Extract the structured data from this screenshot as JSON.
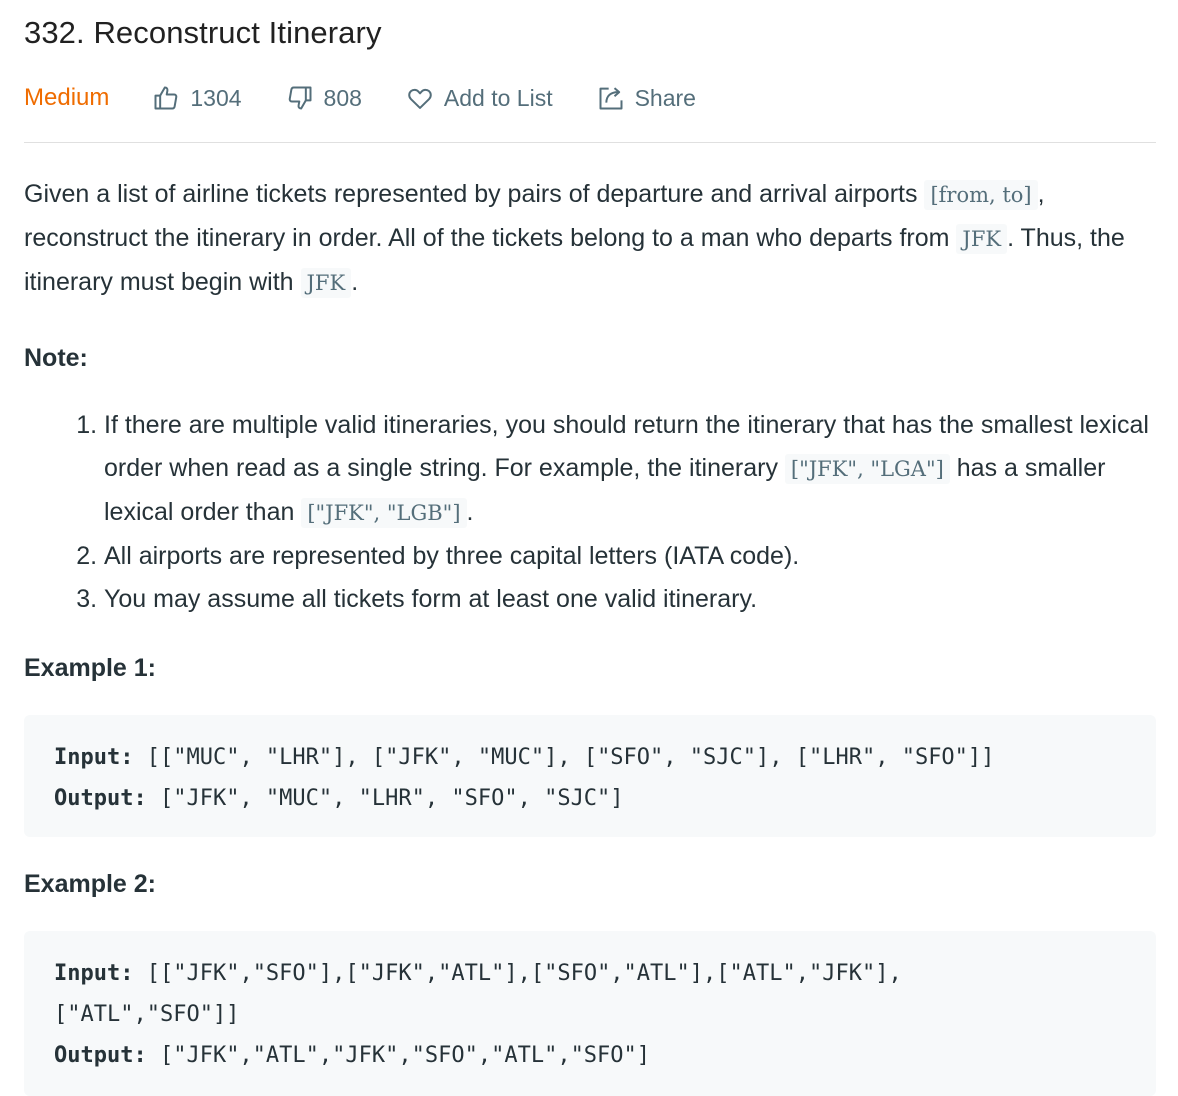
{
  "problem": {
    "title": "332. Reconstruct Itinerary",
    "difficulty": "Medium",
    "likes": "1304",
    "dislikes": "808",
    "add_to_list": "Add to List",
    "share": "Share",
    "colors": {
      "difficulty": "#ef6c00",
      "text": "#263238",
      "muted": "#546e7a",
      "code_bg": "#f7f9fa"
    }
  },
  "description": {
    "part1": "Given a list of airline tickets represented by pairs of departure and arrival airports ",
    "code_pair": "[from, to]",
    "part2": ", reconstruct the itinerary in order. All of the tickets belong to a man who departs from ",
    "code_jfk1": "JFK",
    "part3": ". Thus, the itinerary must begin with ",
    "code_jfk2": "JFK",
    "part4": "."
  },
  "note": {
    "title": "Note:",
    "item1_a": "If there are multiple valid itineraries, you should return the itinerary that has the smallest lexical order when read as a single string. For example, the itinerary ",
    "item1_code1": "[\"JFK\", \"LGA\"]",
    "item1_b": " has a smaller lexical order than ",
    "item1_code2": "[\"JFK\", \"LGB\"]",
    "item1_c": ".",
    "item2": "All airports are represented by three capital letters (IATA code).",
    "item3": "You may assume all tickets form at least one valid itinerary."
  },
  "examples": [
    {
      "title": "Example 1:",
      "input_label": "Input:",
      "input": " [[\"MUC\", \"LHR\"], [\"JFK\", \"MUC\"], [\"SFO\", \"SJC\"], [\"LHR\", \"SFO\"]]",
      "output_label": "Output:",
      "output": " [\"JFK\", \"MUC\", \"LHR\", \"SFO\", \"SJC\"]"
    },
    {
      "title": "Example 2:",
      "input_label": "Input:",
      "input": " [[\"JFK\",\"SFO\"],[\"JFK\",\"ATL\"],[\"SFO\",\"ATL\"],[\"ATL\",\"JFK\"],",
      "input_cont": "[\"ATL\",\"SFO\"]]",
      "output_label": "Output:",
      "output": " [\"JFK\",\"ATL\",\"JFK\",\"SFO\",\"ATL\",\"SFO\"]"
    }
  ]
}
